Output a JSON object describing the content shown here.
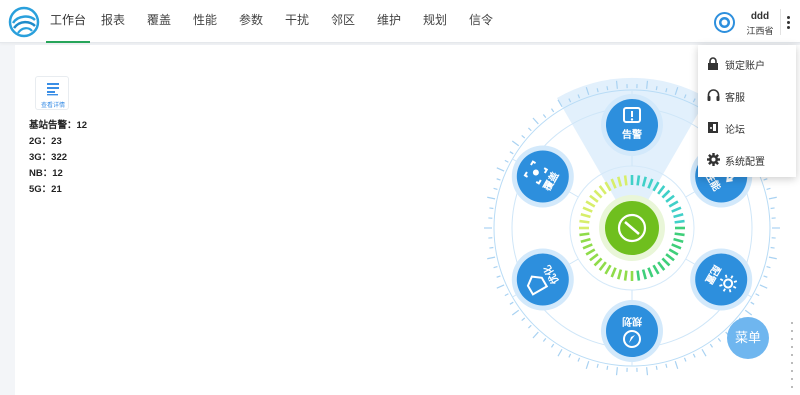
{
  "nav": {
    "items": [
      {
        "label": "工作台",
        "active": true
      },
      {
        "label": "报表",
        "active": false
      },
      {
        "label": "覆盖",
        "active": false
      },
      {
        "label": "性能",
        "active": false
      },
      {
        "label": "参数",
        "active": false
      },
      {
        "label": "干扰",
        "active": false
      },
      {
        "label": "邻区",
        "active": false
      },
      {
        "label": "维护",
        "active": false
      },
      {
        "label": "规划",
        "active": false
      },
      {
        "label": "信令",
        "active": false
      }
    ]
  },
  "user": {
    "name": "ddd",
    "org": "江西省"
  },
  "detail": {
    "label": "查看详情"
  },
  "stats": {
    "lines": [
      "基站告警：12",
      "2G：23",
      "3G：322",
      "NB：12",
      "5G：21"
    ]
  },
  "wheel": {
    "modules": [
      {
        "name": "warning",
        "label": "告警",
        "icon": "alert-icon"
      },
      {
        "name": "performance",
        "label": "性能",
        "icon": "refresh-icon"
      },
      {
        "name": "config",
        "label": "配置",
        "icon": "settings-sun-icon"
      },
      {
        "name": "plan",
        "label": "规划",
        "icon": "compass-icon"
      },
      {
        "name": "optimize",
        "label": "优化",
        "icon": "tag-icon"
      },
      {
        "name": "coverage",
        "label": "覆盖",
        "icon": "scan-icon"
      }
    ]
  },
  "dropdown": {
    "items": [
      {
        "label": "锁定账户",
        "icon": "lock-icon"
      },
      {
        "label": "客服",
        "icon": "headset-icon"
      },
      {
        "label": "论坛",
        "icon": "forum-door-icon"
      },
      {
        "label": "系统配置",
        "icon": "gear-icon"
      }
    ]
  },
  "fab": {
    "label": "菜单"
  },
  "colors": {
    "accent": "#2d8fdd",
    "nav_active": "#27a55a",
    "center_green": "#6fbf1e",
    "fab": "#6fb6ef"
  }
}
